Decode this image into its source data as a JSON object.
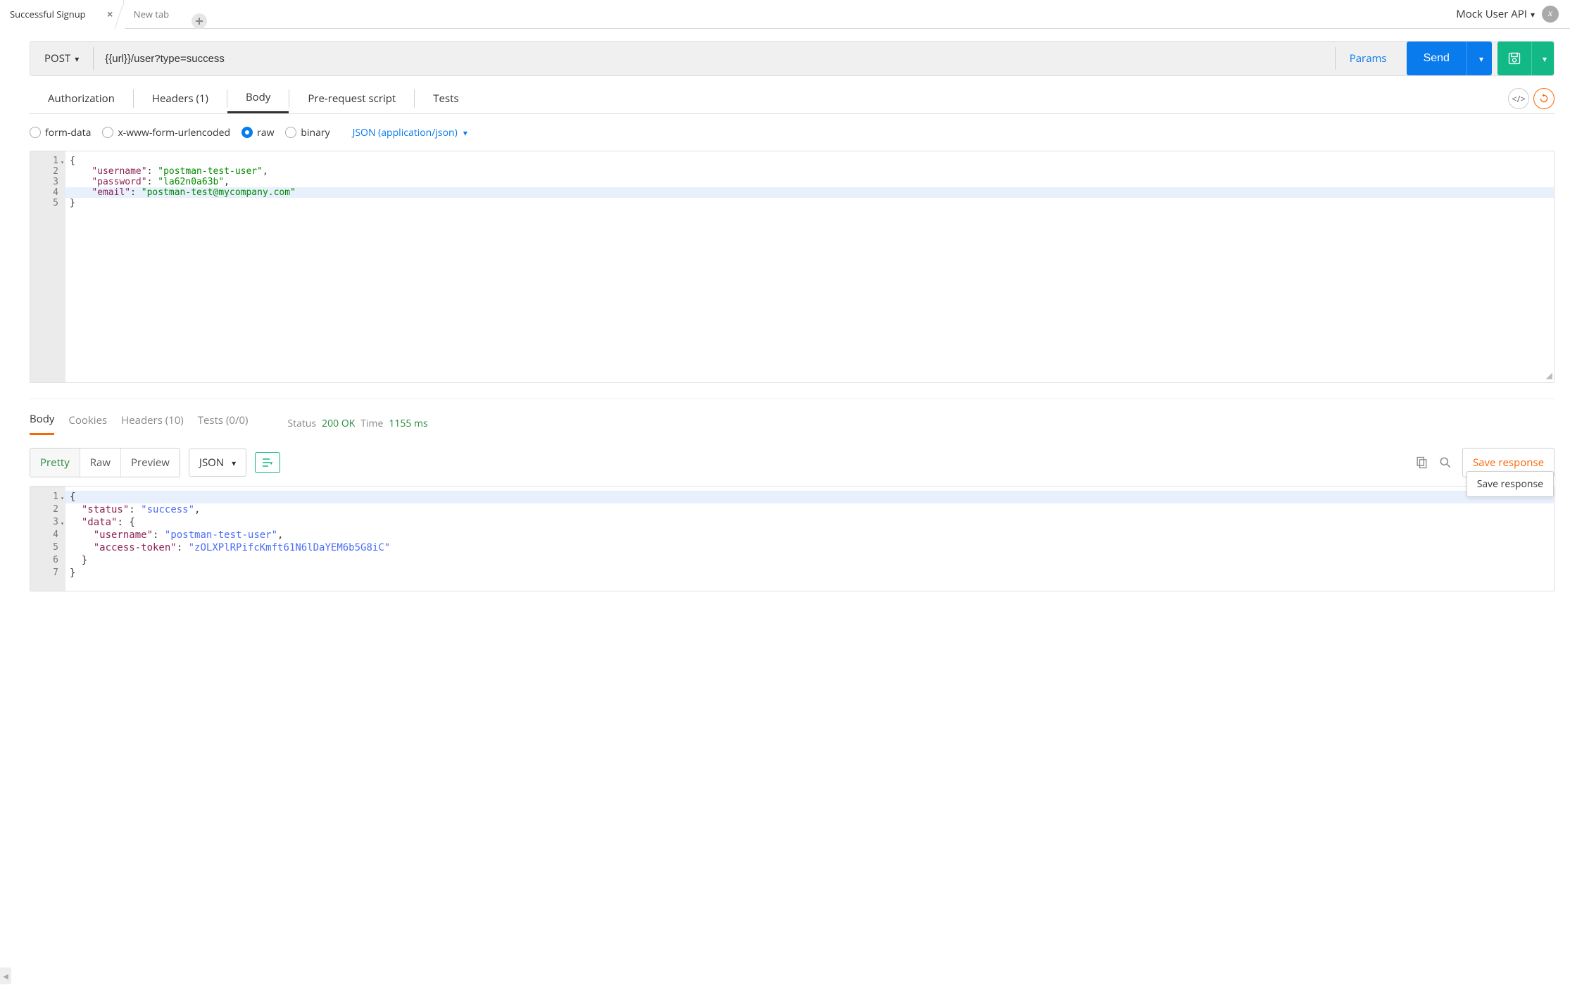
{
  "tabs": {
    "active": "Successful Signup",
    "new_tab": "New tab"
  },
  "environment": "Mock User API",
  "request": {
    "method": "POST",
    "url": "{{url}}/user?type=success",
    "params_label": "Params",
    "send_label": "Send",
    "req_tabs": {
      "authorization": "Authorization",
      "headers": "Headers (1)",
      "body": "Body",
      "prerequest": "Pre-request script",
      "tests": "Tests"
    },
    "body_types": {
      "formdata": "form-data",
      "urlencoded": "x-www-form-urlencoded",
      "raw": "raw",
      "binary": "binary"
    },
    "content_type": "JSON (application/json)",
    "body_lines": [
      "{",
      "    \"username\": \"postman-test-user\",",
      "    \"password\": \"la62n0a63b\",",
      "    \"email\": \"postman-test@mycompany.com\"",
      "}"
    ]
  },
  "response": {
    "tabs": {
      "body": "Body",
      "cookies": "Cookies",
      "headers": "Headers (10)",
      "tests": "Tests (0/0)"
    },
    "status_label": "Status",
    "status_value": "200 OK",
    "time_label": "Time",
    "time_value": "1155 ms",
    "view_tabs": {
      "pretty": "Pretty",
      "raw": "Raw",
      "preview": "Preview"
    },
    "format": "JSON",
    "save_response_label": "Save response",
    "tooltip": "Save response",
    "body_lines": [
      "{",
      "  \"status\": \"success\",",
      "  \"data\": {",
      "    \"username\": \"postman-test-user\",",
      "    \"access-token\": \"zOLXPlRPifcKmft61N6lDaYEM6b5G8iC\"",
      "  }",
      "}"
    ]
  }
}
